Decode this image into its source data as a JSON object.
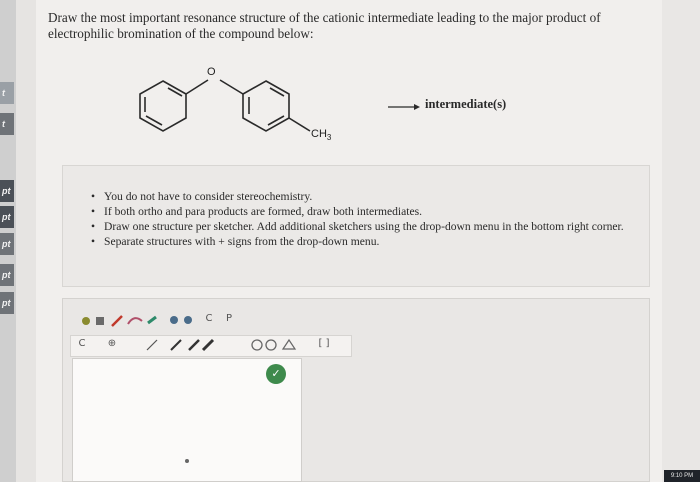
{
  "sidebar": {
    "items": [
      "t",
      "t",
      "pt",
      "pt",
      "pt",
      "pt",
      "pt"
    ]
  },
  "question": {
    "text": "Draw the most important resonance structure of the cationic intermediate leading to the major product of electrophilic bromination of the compound below:"
  },
  "reaction": {
    "oxygen_label": "O",
    "methyl_label": "CH",
    "methyl_subscript": "3",
    "arrow_label": "intermediate(s)"
  },
  "hints": {
    "items": [
      "You do not have to consider stereochemistry.",
      "If both ortho and para products are formed, draw both intermediates.",
      "Draw one structure per sketcher. Add additional sketchers using the drop-down menu in the bottom right corner.",
      "Separate structures with + signs from the drop-down menu."
    ]
  },
  "sketcher": {
    "toolbar1_icons": [
      "pointer-icon",
      "undo-icon",
      "pencil-icon",
      "lasso-icon",
      "zoom-in-icon",
      "zoom-out-icon",
      "clean-icon",
      "periodic-icon"
    ],
    "toolbar1_symbols": [
      "C",
      "P"
    ],
    "toolbar2_icons": [
      "element-c-icon",
      "charge-icon",
      "single-bond-icon",
      "double-bond-icon",
      "ring-icon",
      "template-icon"
    ],
    "toolbar2_symbols": [
      "C",
      "⊕",
      "[ ]"
    ],
    "status_symbol": "✓"
  },
  "taskbar": {
    "clock": "9:10 PM"
  },
  "colors": {
    "background": "#f1efed",
    "status_green": "#3e8a4c",
    "sidebar_dark": "#4b5057"
  }
}
